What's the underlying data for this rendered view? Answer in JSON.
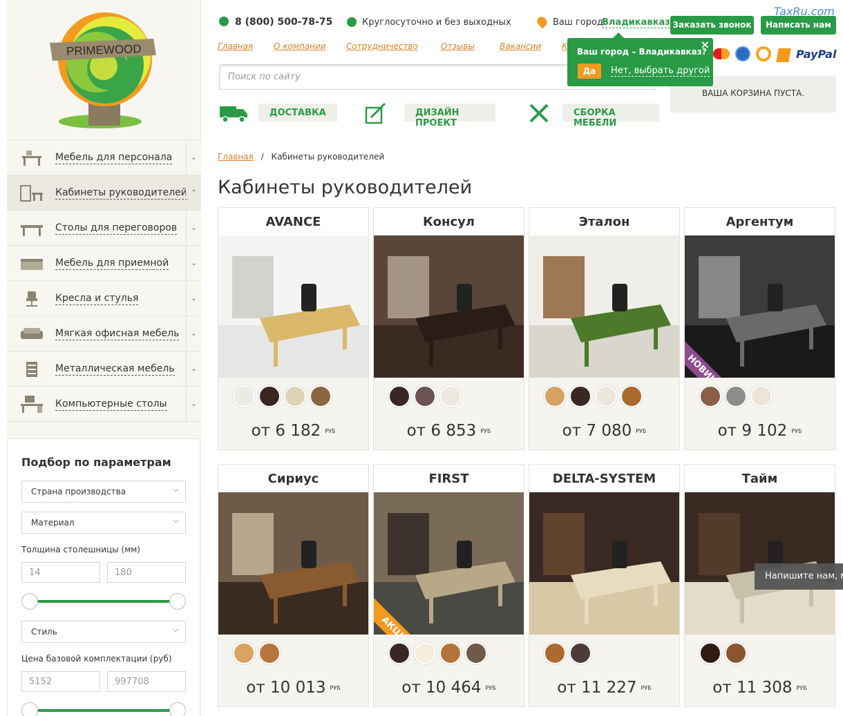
{
  "brand": {
    "logo_text": "PRIMEWOOD",
    "watermark": "TaxRu.com"
  },
  "header": {
    "phone": "8 (800) 500-78-75",
    "hours": "Круглосуточно и без выходных",
    "city_label": "Ваш город:",
    "city_value": "Владикавказ",
    "call_button": "Заказать звонок",
    "write_button": "Написать нам",
    "nav": [
      "Главная",
      "О компании",
      "Сотрудничество",
      "Отзывы",
      "Вакансии",
      "К"
    ],
    "search_placeholder": "Поиск по сайту",
    "services": [
      "ДОСТАВКА",
      "ДИЗАЙН ПРОЕКТ",
      "СБОРКА МЕБЕЛИ"
    ],
    "payments": [
      "PayPal",
      "MasterCard",
      "WebMoney",
      "QIWI",
      "Яндекс.Деньги"
    ],
    "cart_text": "ВАША КОРЗИНА ПУСТА."
  },
  "city_popup": {
    "question": "Ваш город – Владикавказ?",
    "yes": "Да",
    "other": "Нет, выбрать другой"
  },
  "sidebar": {
    "items": [
      {
        "label": "Мебель для персонала",
        "icon": "desk-icon",
        "active": false
      },
      {
        "label": "Кабинеты руководителей",
        "icon": "office-icon",
        "active": true
      },
      {
        "label": "Столы для переговоров",
        "icon": "table-icon",
        "active": false
      },
      {
        "label": "Мебель для приемной",
        "icon": "reception-icon",
        "active": false
      },
      {
        "label": "Кресла и стулья",
        "icon": "chair-icon",
        "active": false
      },
      {
        "label": "Мягкая офисная мебель",
        "icon": "sofa-icon",
        "active": false
      },
      {
        "label": "Металлическая мебель",
        "icon": "cabinet-icon",
        "active": false
      },
      {
        "label": "Компьютерные столы",
        "icon": "computer-desk-icon",
        "active": false
      }
    ]
  },
  "filter": {
    "title": "Подбор по параметрам",
    "country": "Страна производства",
    "material": "Материал",
    "thickness_label": "Толщина столешницы (мм)",
    "thickness_min": "14",
    "thickness_max": "180",
    "style": "Стиль",
    "price_label": "Цена базовой комплектации (руб)",
    "price_min": "5152",
    "price_max": "997708"
  },
  "breadcrumb": {
    "home": "Главная",
    "sep": "/",
    "current": "Кабинеты руководителей"
  },
  "page_title": "Кабинеты руководителей",
  "currency": "РУБ",
  "products": [
    {
      "name": "AVANCE",
      "price": "от 6 182",
      "swatches": [
        "#eceae4",
        "#3a2620",
        "#ddd3b6",
        "#8a6540"
      ],
      "ribbon": ""
    },
    {
      "name": "Консул",
      "price": "от 6 853",
      "swatches": [
        "#3a2622",
        "#6b5450",
        "#ece8df"
      ],
      "ribbon": ""
    },
    {
      "name": "Эталон",
      "price": "от 7 080",
      "swatches": [
        "#d7a364",
        "#3b2722",
        "#ebe7dc",
        "#a8692c"
      ],
      "ribbon": ""
    },
    {
      "name": "Аргентум",
      "price": "от 9 102",
      "swatches": [
        "#8a5f45",
        "#8c8c8a",
        "#ede6d6"
      ],
      "ribbon": "НОВИНКА"
    },
    {
      "name": "Сириус",
      "price": "от 10 013",
      "swatches": [
        "#d9a460",
        "#b8753c"
      ],
      "ribbon": ""
    },
    {
      "name": "FIRST",
      "price": "от 10 464",
      "swatches": [
        "#3a2723",
        "#f5eedc",
        "#b2743a",
        "#6e5a48"
      ],
      "ribbon": "АКЦИЯ"
    },
    {
      "name": "DELTA-SYSTEM",
      "price": "от 11 227",
      "swatches": [
        "#ad6a2f",
        "#4c3b37"
      ],
      "ribbon": ""
    },
    {
      "name": "Тайм",
      "price": "от 11 308",
      "swatches": [
        "#2e1c14",
        "#8a5530"
      ],
      "ribbon": ""
    }
  ],
  "chat_tooltip": "Напишите нам, м"
}
